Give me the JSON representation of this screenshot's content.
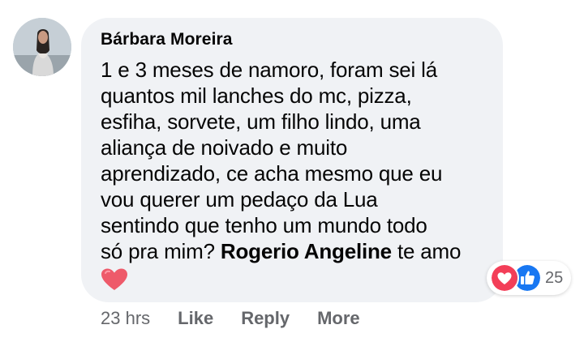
{
  "comment": {
    "author": "Bárbara Moreira",
    "text_main": "1 e 3 meses de namoro, foram sei lá\nquantos mil lanches do mc, pizza,\nesfiha, sorvete, um filho lindo, uma\naliança de noivado e muito\naprendizado, ce acha mesmo que eu\nvou querer um pedaço da Lua\nsentindo que tenho um mundo todo\nsó pra mim? ",
    "mention": "Rogerio Angeline",
    "text_tail": " te amo",
    "emoji": "heart-emoji"
  },
  "reactions": {
    "icons": [
      "love-icon",
      "like-icon"
    ],
    "count": "25",
    "love_color": "#f33e58",
    "like_color": "#1877f2"
  },
  "actions": {
    "timestamp": "23 hrs",
    "like_label": "Like",
    "reply_label": "Reply",
    "more_label": "More"
  },
  "colors": {
    "bubble": "#f0f2f5",
    "text": "#050505",
    "secondary": "#65676b",
    "emoji_heart": "#ee5566"
  }
}
